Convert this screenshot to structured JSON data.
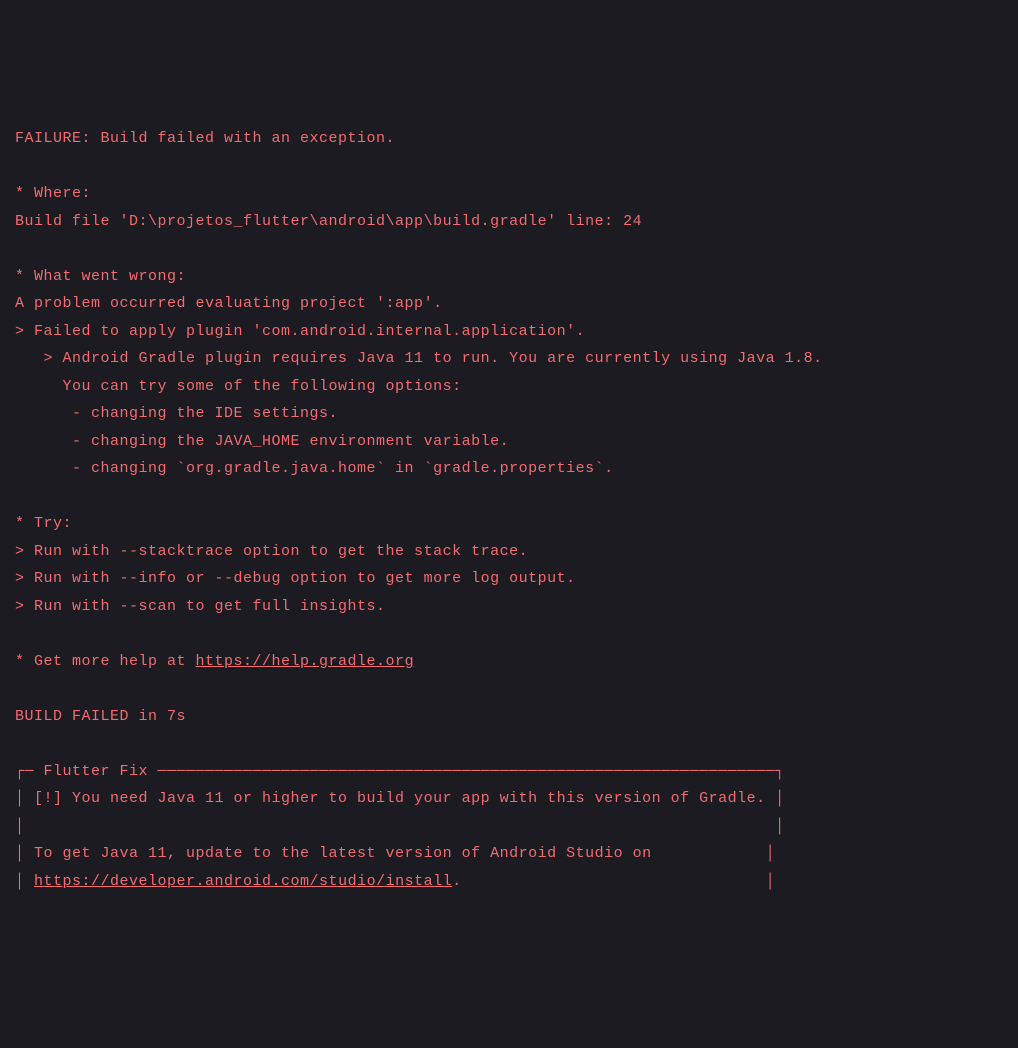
{
  "terminal": {
    "blank0": "",
    "failure_header": "FAILURE: Build failed with an exception.",
    "blank1": "",
    "where_header": "* Where:",
    "where_detail": "Build file 'D:\\projetos_flutter\\android\\app\\build.gradle' line: 24",
    "blank2": "",
    "wrong_header": "* What went wrong:",
    "wrong_line1": "A problem occurred evaluating project ':app'.",
    "wrong_line2": "> Failed to apply plugin 'com.android.internal.application'.",
    "wrong_line3": "   > Android Gradle plugin requires Java 11 to run. You are currently using Java 1.8.",
    "wrong_line4": "     You can try some of the following options:",
    "wrong_line5": "      - changing the IDE settings.",
    "wrong_line6": "      - changing the JAVA_HOME environment variable.",
    "wrong_line7": "      - changing `org.gradle.java.home` in `gradle.properties`.",
    "blank3": "",
    "try_header": "* Try:",
    "try_line1": "> Run with --stacktrace option to get the stack trace.",
    "try_line2": "> Run with --info or --debug option to get more log output.",
    "try_line3": "> Run with --scan to get full insights.",
    "blank4": "",
    "help_prefix": "* Get more help at ",
    "help_link": "https://help.gradle.org",
    "blank5": "",
    "build_failed": "BUILD FAILED in 7s",
    "blank6": "",
    "fix_border_top": "┌─ Flutter Fix ─────────────────────────────────────────────────────────────────┐",
    "fix_line1": "│ [!] You need Java 11 or higher to build your app with this version of Gradle. │",
    "fix_line2": "│                                                                               │",
    "fix_line3": "│ To get Java 11, update to the latest version of Android Studio on            │",
    "fix_line4_prefix": "│ ",
    "fix_line4_link": "https://developer.android.com/studio/install",
    "fix_line4_suffix": ".                                │"
  }
}
